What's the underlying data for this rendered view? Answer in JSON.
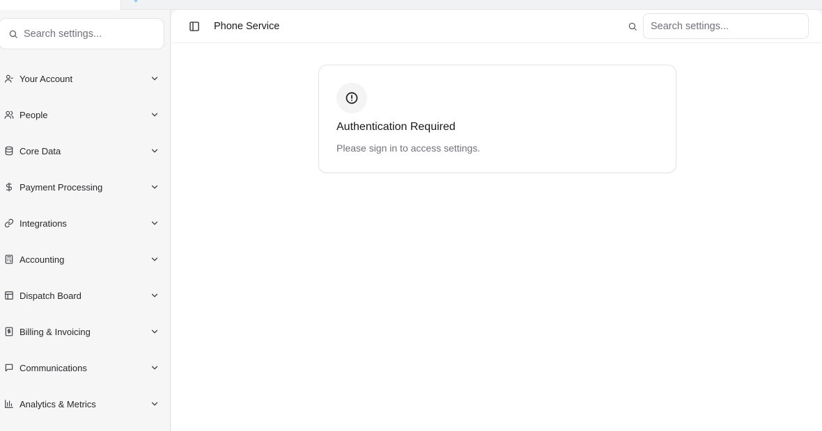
{
  "sidebar": {
    "search_placeholder": "Search settings...",
    "items": [
      {
        "label": "Your Account",
        "icon": "user-icon"
      },
      {
        "label": "People",
        "icon": "users-icon"
      },
      {
        "label": "Core Data",
        "icon": "database-icon"
      },
      {
        "label": "Payment Processing",
        "icon": "dollar-icon"
      },
      {
        "label": "Integrations",
        "icon": "link-icon"
      },
      {
        "label": "Accounting",
        "icon": "calculator-icon"
      },
      {
        "label": "Dispatch Board",
        "icon": "layout-icon"
      },
      {
        "label": "Billing & Invoicing",
        "icon": "receipt-icon"
      },
      {
        "label": "Communications",
        "icon": "message-icon"
      },
      {
        "label": "Analytics & Metrics",
        "icon": "bar-chart-icon"
      }
    ]
  },
  "header": {
    "title": "Phone Service",
    "search_placeholder": "Search settings..."
  },
  "card": {
    "title": "Authentication Required",
    "description": "Please sign in to access settings.",
    "icon": "alert-circle-icon"
  },
  "colors": {
    "sidebar_bg": "#f6f6f7",
    "border": "#e4e4e7",
    "muted_text": "#71717a",
    "text": "#18181b"
  }
}
